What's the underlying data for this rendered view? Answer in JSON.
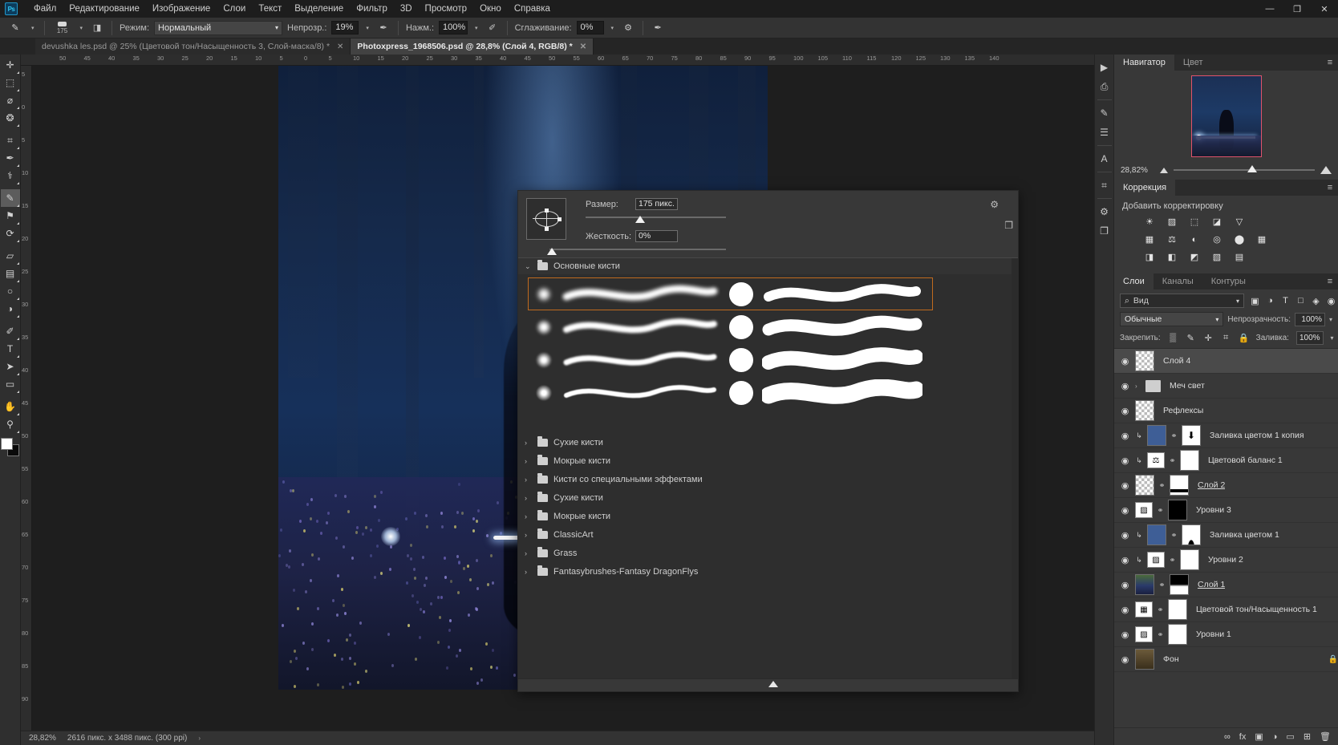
{
  "app": {
    "logo": "Ps"
  },
  "menubar": {
    "items": [
      "Файл",
      "Редактирование",
      "Изображение",
      "Слои",
      "Текст",
      "Выделение",
      "Фильтр",
      "3D",
      "Просмотр",
      "Окно",
      "Справка"
    ],
    "window_controls": [
      "—",
      "❐",
      "✕"
    ]
  },
  "options_bar": {
    "brush_size_label": "175",
    "mode_label": "Режим:",
    "mode_value": "Нормальный",
    "opacity_label": "Непрозр.:",
    "opacity_value": "19%",
    "flow_label": "Нажм.:",
    "flow_value": "100%",
    "smoothing_label": "Сглаживание:",
    "smoothing_value": "0%"
  },
  "document_tabs": [
    {
      "title": "devushka les.psd @ 25% (Цветовой тон/Насыщенность 3, Слой-маска/8) *",
      "close": "✕",
      "active": false
    },
    {
      "title": "Photoxpress_1968506.psd @ 28,8% (Слой 4, RGB/8) *",
      "close": "✕",
      "active": true
    }
  ],
  "ruler": {
    "h_ticks": [
      "50",
      "45",
      "40",
      "35",
      "30",
      "25",
      "20",
      "15",
      "10",
      "5",
      "0",
      "5",
      "10",
      "15",
      "20",
      "25",
      "30",
      "35",
      "40",
      "45",
      "50",
      "55",
      "60",
      "65",
      "70",
      "75",
      "80",
      "85",
      "90",
      "95",
      "100",
      "105",
      "110",
      "115",
      "120",
      "125",
      "130",
      "135",
      "140"
    ],
    "v_ticks": [
      "5",
      "0",
      "5",
      "10",
      "15",
      "20",
      "25",
      "30",
      "35",
      "40",
      "45",
      "50",
      "55",
      "60",
      "65",
      "70",
      "75",
      "80",
      "85",
      "90"
    ]
  },
  "toolbar": {
    "tools": [
      {
        "name": "move-tool",
        "glyph": "✛"
      },
      {
        "name": "marquee-tool",
        "glyph": "⬚"
      },
      {
        "name": "lasso-tool",
        "glyph": "⌀"
      },
      {
        "name": "quick-select-tool",
        "glyph": "❂"
      },
      {
        "name": "crop-tool",
        "glyph": "⌗"
      },
      {
        "name": "eyedropper-tool",
        "glyph": "✒"
      },
      {
        "name": "spot-heal-tool",
        "glyph": "⚕"
      },
      {
        "name": "brush-tool",
        "glyph": "✎",
        "active": true
      },
      {
        "name": "clone-stamp-tool",
        "glyph": "⚑"
      },
      {
        "name": "history-brush-tool",
        "glyph": "⟳"
      },
      {
        "name": "eraser-tool",
        "glyph": "▱"
      },
      {
        "name": "gradient-tool",
        "glyph": "▤"
      },
      {
        "name": "blur-tool",
        "glyph": "○"
      },
      {
        "name": "dodge-tool",
        "glyph": "◑"
      },
      {
        "name": "pen-tool",
        "glyph": "✐"
      },
      {
        "name": "type-tool",
        "glyph": "T"
      },
      {
        "name": "path-select-tool",
        "glyph": "➤"
      },
      {
        "name": "shape-tool",
        "glyph": "▭"
      },
      {
        "name": "hand-tool",
        "glyph": "✋"
      },
      {
        "name": "zoom-tool",
        "glyph": "⚲"
      }
    ]
  },
  "brush_panel": {
    "size_label": "Размер:",
    "size_value": "175 пикс.",
    "hardness_label": "Жесткость:",
    "hardness_value": "0%",
    "gear_icon": "⚙",
    "new_preset_icon": "❐",
    "group_open": {
      "label": "Основные кисти",
      "chevron": "⌄"
    },
    "folders": [
      {
        "label": "Сухие кисти",
        "chevron": "›"
      },
      {
        "label": "Мокрые кисти",
        "chevron": "›"
      },
      {
        "label": "Кисти со специальными эффектами",
        "chevron": "›"
      },
      {
        "label": "Сухие кисти",
        "chevron": "›"
      },
      {
        "label": "Мокрые кисти",
        "chevron": "›"
      },
      {
        "label": "ClassicArt",
        "chevron": "›"
      },
      {
        "label": "Grass",
        "chevron": "›"
      },
      {
        "label": "Fantasybrushes-Fantasy DragonFlys",
        "chevron": "›"
      }
    ]
  },
  "right_rail": {
    "icons": [
      {
        "name": "play-icon",
        "glyph": "▶"
      },
      {
        "name": "actions-icon",
        "glyph": "⎙"
      },
      {
        "name": "brush-settings-icon",
        "glyph": "✎"
      },
      {
        "name": "adjust-sliders-icon",
        "glyph": "☰"
      },
      {
        "name": "character-icon",
        "glyph": "A"
      },
      {
        "name": "properties-icon",
        "glyph": "⌗"
      },
      {
        "name": "settings-icon",
        "glyph": "⚙"
      },
      {
        "name": "new-layer-icon",
        "glyph": "❐"
      }
    ]
  },
  "navigator": {
    "tabs": [
      {
        "label": "Навигатор",
        "active": true
      },
      {
        "label": "Цвет",
        "active": false
      }
    ],
    "menu_glyph": "≡",
    "zoom_value": "28,82%"
  },
  "adjustments": {
    "tab": "Коррекция",
    "menu_glyph": "≡",
    "title": "Добавить корректировку",
    "rows": [
      [
        {
          "name": "brightness-contrast-icon",
          "glyph": "☀"
        },
        {
          "name": "levels-icon",
          "glyph": "▨"
        },
        {
          "name": "curves-icon",
          "glyph": "⬚"
        },
        {
          "name": "exposure-icon",
          "glyph": "◪"
        },
        {
          "name": "vibrance-icon",
          "glyph": "▽"
        }
      ],
      [
        {
          "name": "hue-saturation-icon",
          "glyph": "▦"
        },
        {
          "name": "color-balance-icon",
          "glyph": "⚖"
        },
        {
          "name": "black-white-icon",
          "glyph": "◐"
        },
        {
          "name": "photo-filter-icon",
          "glyph": "◎"
        },
        {
          "name": "channel-mixer-icon",
          "glyph": "⬤"
        },
        {
          "name": "color-lookup-icon",
          "glyph": "▦"
        }
      ],
      [
        {
          "name": "invert-icon",
          "glyph": "◨"
        },
        {
          "name": "posterize-icon",
          "glyph": "◧"
        },
        {
          "name": "threshold-icon",
          "glyph": "◩"
        },
        {
          "name": "gradient-map-icon",
          "glyph": "▧"
        },
        {
          "name": "selective-color-icon",
          "glyph": "▤"
        }
      ]
    ]
  },
  "layers": {
    "tabs": [
      {
        "label": "Слои",
        "active": true
      },
      {
        "label": "Каналы",
        "active": false
      },
      {
        "label": "Контуры",
        "active": false
      }
    ],
    "menu_glyph": "≡",
    "filter_placeholder": "Вид",
    "filter_value": "Вид",
    "search_icon": "⌕",
    "filter_icons": [
      {
        "name": "filter-pixel-icon",
        "glyph": "▣"
      },
      {
        "name": "filter-adjustment-icon",
        "glyph": "◑"
      },
      {
        "name": "filter-type-icon",
        "glyph": "T"
      },
      {
        "name": "filter-shape-icon",
        "glyph": "□"
      },
      {
        "name": "filter-smart-icon",
        "glyph": "◈"
      },
      {
        "name": "filter-toggle-icon",
        "glyph": "◉"
      }
    ],
    "blend_mode": "Обычные",
    "opacity_label": "Непрозрачность:",
    "opacity_value": "100%",
    "lock_label": "Закрепить:",
    "lock_icons": [
      {
        "name": "lock-transparent-icon",
        "glyph": "▒"
      },
      {
        "name": "lock-image-icon",
        "glyph": "✎"
      },
      {
        "name": "lock-position-icon",
        "glyph": "✛"
      },
      {
        "name": "lock-artboard-icon",
        "glyph": "⌗"
      },
      {
        "name": "lock-all-icon",
        "glyph": "🔒"
      }
    ],
    "fill_label": "Заливка:",
    "fill_value": "100%",
    "items": [
      {
        "name": "Слой 4",
        "thumb": "checker",
        "selected": true,
        "has_mask": false,
        "has_link": false,
        "eye": true
      },
      {
        "name": "Меч свет",
        "thumb": "folder",
        "group": true,
        "chevron": "›",
        "eye": true
      },
      {
        "name": "Рефлексы",
        "thumb": "checker",
        "eye": true
      },
      {
        "name": "Заливка цветом 1 копия",
        "thumb": "blue",
        "has_mask": true,
        "mask": "white-arrow",
        "clipped": true,
        "eye": true
      },
      {
        "name": "Цветовой баланс 1",
        "thumb": "adj-balance",
        "has_mask": true,
        "mask": "white",
        "clipped": true,
        "eye": true
      },
      {
        "name": "Слой 2",
        "thumb": "checker-dark",
        "has_mask": true,
        "mask": "white-line",
        "underline": true,
        "eye": true
      },
      {
        "name": "Уровни 3",
        "thumb": "adj-levels",
        "has_mask": true,
        "mask": "black",
        "eye": true
      },
      {
        "name": "Заливка цветом 1",
        "thumb": "blue",
        "has_mask": true,
        "mask": "white-curve",
        "clipped": true,
        "eye": true
      },
      {
        "name": "Уровни 2",
        "thumb": "adj-levels",
        "has_mask": true,
        "mask": "white",
        "clipped": true,
        "eye": true
      },
      {
        "name": "Слой 1",
        "thumb": "photo",
        "has_mask": true,
        "mask": "black-half",
        "underline": true,
        "eye": true
      },
      {
        "name": "Цветовой тон/Насыщенность 1",
        "thumb": "adj-hue",
        "has_mask": true,
        "mask": "white",
        "eye": true
      },
      {
        "name": "Уровни 1",
        "thumb": "adj-levels",
        "has_mask": true,
        "mask": "white",
        "eye": true
      },
      {
        "name": "Фон",
        "thumb": "sepia",
        "locked": true,
        "lock_glyph": "🔒",
        "eye": true
      }
    ],
    "footer_icons": [
      {
        "name": "link-layers-icon",
        "glyph": "∞"
      },
      {
        "name": "layer-style-icon",
        "glyph": "fx"
      },
      {
        "name": "add-mask-icon",
        "glyph": "▣"
      },
      {
        "name": "new-adjustment-icon",
        "glyph": "◑"
      },
      {
        "name": "new-group-icon",
        "glyph": "▭"
      },
      {
        "name": "new-layer-icon",
        "glyph": "⊞"
      },
      {
        "name": "delete-layer-icon",
        "glyph": "🗑"
      }
    ]
  },
  "statusbar": {
    "zoom": "28,82%",
    "dimensions": "2616 пикс. x 3488 пикс. (300 ppi)",
    "arrow": "›"
  }
}
